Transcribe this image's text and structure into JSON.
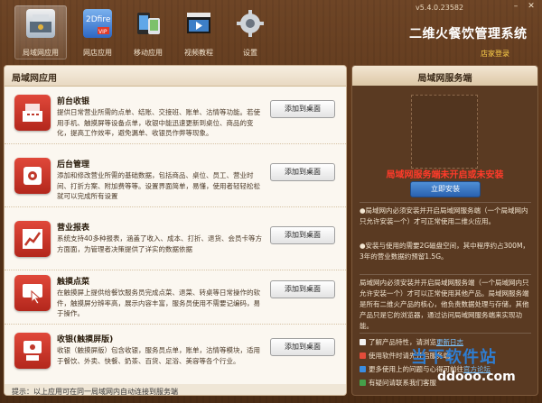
{
  "app": {
    "version": "v5.4.0.23582",
    "title": "二维火餐饮管理系统",
    "store_login": "店家登录"
  },
  "nav": [
    {
      "label": "局域网应用",
      "icon": "restaurant-icon",
      "active": true
    },
    {
      "label": "网店应用",
      "icon": "2dfire-vip-icon",
      "active": false
    },
    {
      "label": "移动应用",
      "icon": "mobile-icon",
      "active": false
    },
    {
      "label": "视频教程",
      "icon": "video-icon",
      "active": false
    },
    {
      "label": "设置",
      "icon": "gear-icon",
      "active": false
    }
  ],
  "left": {
    "title": "局域网应用",
    "add_label": "添加到桌面",
    "apps": [
      {
        "title": "前台收银",
        "desc": "提供日常营业所需的点单、结账、交接班、账单、沽情等功能。若使用手机、触摸屏等设备点单，收银中能迅速更新到桌位、商品的变化，提高工作效率，避免漏单、收银员作弊等现象。",
        "icon": "cash-register-icon"
      },
      {
        "title": "后台管理",
        "desc": "添加和修改营业所需的基础数据，包括商品、桌位、员工、营业时间、打折方案、附加费等等。设置界面简单，易懂，使用者轻轻松松就可以完成所有设置",
        "icon": "settings-cart-icon"
      },
      {
        "title": "营业报表",
        "desc": "系统支持40多种报表，涵盖了收入、成本、打折、退货、会员卡等方方面面，为管理者决策提供了详实的数据依据",
        "icon": "report-chart-icon"
      },
      {
        "title": "触摸点菜",
        "desc": "在触摸屏上提供给餐饮服务员完成点菜、退菜、转桌等日常操作的软件，触摸屏分辨率高，展示内容丰富，服务员使用不需要记编码，易于操作。",
        "icon": "touch-icon"
      },
      {
        "title": "收银(触摸屏版)",
        "desc": "收银（触摸屏版）包含收银，服务员点单，账单，沽情等模块，适用于餐饮、外卖、快餐、奶茶、百货、足浴、美容等各个行业。",
        "icon": "touch-register-icon"
      }
    ],
    "tip": "提示：以上应用可在同一局域网内自动连接到服务端"
  },
  "right": {
    "title": "局域网服务端",
    "warning": "局域网服务端未开启或未安装",
    "install_label": "立即安装",
    "info1": "●局域网内必须安装并开启局域网服务端（一个局域网内只允许安装一个）才可正常使用二维火应用。",
    "info2": "●安装与使用的需要2G磁盘空间，其中程序约占300M，3年的营业数据约预留1.5G。",
    "info3": "局域网内必须安装并开启局域网服务端（一个局域网内只允许安装一个）才可以正常使用其他产品。局域网服务端是所有二维火产品的核心，他负责数据处理与存储，其他产品只是它的浏览器，通过访问局域网服务端来实现功能。",
    "links": [
      {
        "text": "了解产品特性，请浏览",
        "link": "更新日志",
        "color": "#f2f2f2"
      },
      {
        "text": "使用软件时请先开启服务端",
        "link": "",
        "color": "#e24c3a"
      },
      {
        "text": "更多使用上的问题与心得可前往",
        "link": "官方论坛",
        "color": "#3b8de0"
      },
      {
        "text": "有疑问请联系我们客服",
        "link": "",
        "color": "#46a04a"
      }
    ]
  },
  "watermark": {
    "line1": "当下软件站",
    "line2": "ddooo.com"
  }
}
